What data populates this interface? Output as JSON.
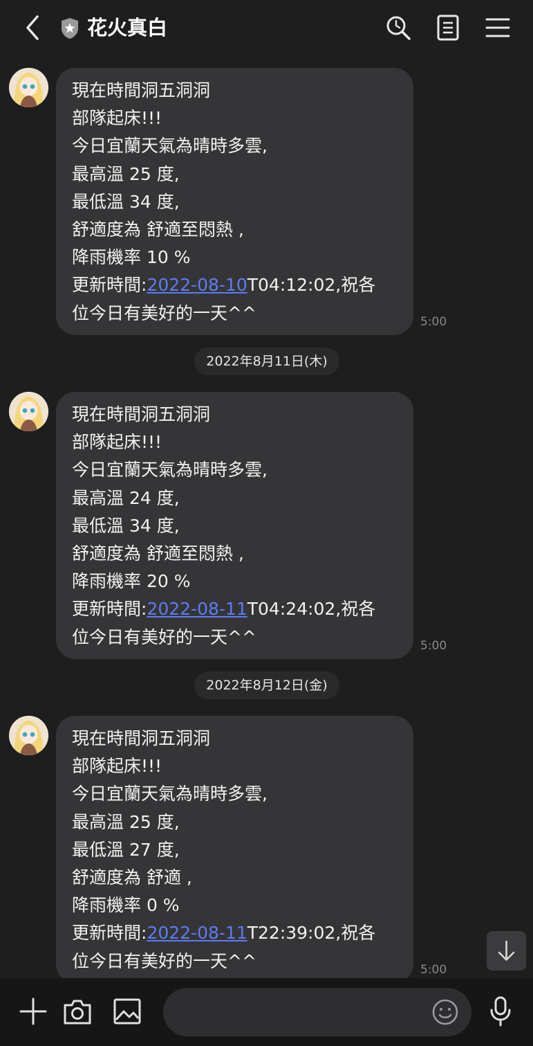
{
  "header": {
    "title": "花火真白",
    "icons": [
      "back-icon",
      "shield-star-icon",
      "search-icon",
      "notes-icon",
      "menu-icon"
    ]
  },
  "messages": [
    {
      "lines": [
        "現在時間洞五洞洞",
        "部隊起床!!!",
        "今日宜蘭天氣為晴時多雲,",
        "最高溫 25 度,",
        "最低溫 34 度,",
        "舒適度為 舒適至悶熱 ,",
        "降雨機率 10 %"
      ],
      "update_prefix": "更新時間:",
      "update_link": "2022-08-10",
      "update_suffix": "T04:12:02,祝各",
      "last_line": "位今日有美好的一天^^",
      "time": "5:00"
    },
    {
      "lines": [
        "現在時間洞五洞洞",
        "部隊起床!!!",
        "今日宜蘭天氣為晴時多雲,",
        "最高溫 24 度,",
        "最低溫 34 度,",
        "舒適度為 舒適至悶熱 ,",
        "降雨機率 20 %"
      ],
      "update_prefix": "更新時間:",
      "update_link": "2022-08-11",
      "update_suffix": "T04:24:02,祝各",
      "last_line": "位今日有美好的一天^^",
      "time": "5:00"
    },
    {
      "lines": [
        "現在時間洞五洞洞",
        "部隊起床!!!",
        "今日宜蘭天氣為晴時多雲,",
        "最高溫 25 度,",
        "最低溫 27 度,",
        "舒適度為 舒適 ,",
        "降雨機率 0 %"
      ],
      "update_prefix": "更新時間:",
      "update_link": "2022-08-11",
      "update_suffix": "T22:39:02,祝各",
      "last_line": "位今日有美好的一天^^",
      "time": "5:00"
    }
  ],
  "date_separators": [
    "2022年8月11日(木)",
    "2022年8月12日(金)"
  ],
  "bottom_bar": {
    "icons": [
      "plus-icon",
      "camera-icon",
      "image-icon",
      "emoji-icon",
      "microphone-icon"
    ],
    "input_placeholder": ""
  },
  "colors": {
    "background": "#1e1e1f",
    "bubble": "#353537",
    "link": "#5d7cf2",
    "bottom_bar": "#161617"
  }
}
